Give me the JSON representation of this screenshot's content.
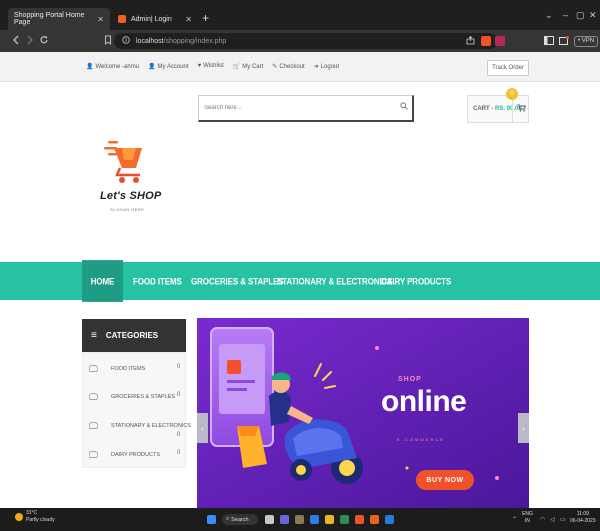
{
  "browser": {
    "tabs": [
      {
        "title": "Shopping Portal Home Page",
        "close": "✕"
      },
      {
        "title": "Admin| Login",
        "close": "✕"
      }
    ],
    "new_tab": "+",
    "window_controls": {
      "chevron": "⌄",
      "minimize": "–",
      "maximize": "▢",
      "close": "✕"
    },
    "url_host": "localhost",
    "url_path": "/shopping/index.php",
    "vpn_label": "• VPN",
    "accent_colors": {
      "tab_favicon": "#e8641e",
      "brave": "#f0502a"
    }
  },
  "topbar": {
    "links": [
      {
        "icon": "user-icon",
        "glyph": "👤",
        "label": "Welcome -ahmu"
      },
      {
        "icon": "user-icon",
        "glyph": "👤",
        "label": "My Account"
      },
      {
        "icon": "heart-icon",
        "glyph": "♥",
        "label": "Wishlist"
      },
      {
        "icon": "cart-icon",
        "glyph": "🛒",
        "label": "My Cart"
      },
      {
        "icon": "key-icon",
        "glyph": "✎",
        "label": "Checkout"
      },
      {
        "icon": "signout-icon",
        "glyph": "➜",
        "label": "Logout"
      }
    ],
    "track_order": "Track Order"
  },
  "search": {
    "placeholder": "Search here...",
    "icon": "search-icon"
  },
  "cart": {
    "label": "CART -",
    "amount": "RS. 00.00",
    "badge": "0",
    "icon": "cart-icon"
  },
  "logo": {
    "brand": "Let's SHOP",
    "slogan": "SLOGAN HERE"
  },
  "nav": {
    "items": [
      "HOME",
      "FOOD ITEMS",
      "GROCERIES & STAPLES",
      "STATIONARY & ELECTRONICS",
      "DAIRY PRODUCTS"
    ],
    "color": "#27c2a3",
    "active_color": "#1f9c84"
  },
  "categories": {
    "heading": "CATEGORIES",
    "items": [
      {
        "label": "FOOD ITEMS",
        "count": "0"
      },
      {
        "label": "GROCERIES & STAPLES",
        "count": "0"
      },
      {
        "label": "STATIONARY & ELECTRONICS",
        "count": "0"
      },
      {
        "label": "DAIRY PRODUCTS",
        "count": "0"
      }
    ]
  },
  "banner": {
    "kicker": "SHOP",
    "headline": "online",
    "sub": "E-COMMERCE",
    "cta": "BUY NOW",
    "prev": "‹",
    "next": "›",
    "colors": {
      "bg": "#5b1ea6",
      "accent": "#f0502a",
      "pink": "#ff8ac0"
    }
  },
  "taskbar": {
    "weather_temp": "31°C",
    "weather_desc": "Partly cloudy",
    "search_label": "Search",
    "lang_top": "ENG",
    "lang_bottom": "IN",
    "time": "11:09",
    "date": "06-04-2023"
  }
}
